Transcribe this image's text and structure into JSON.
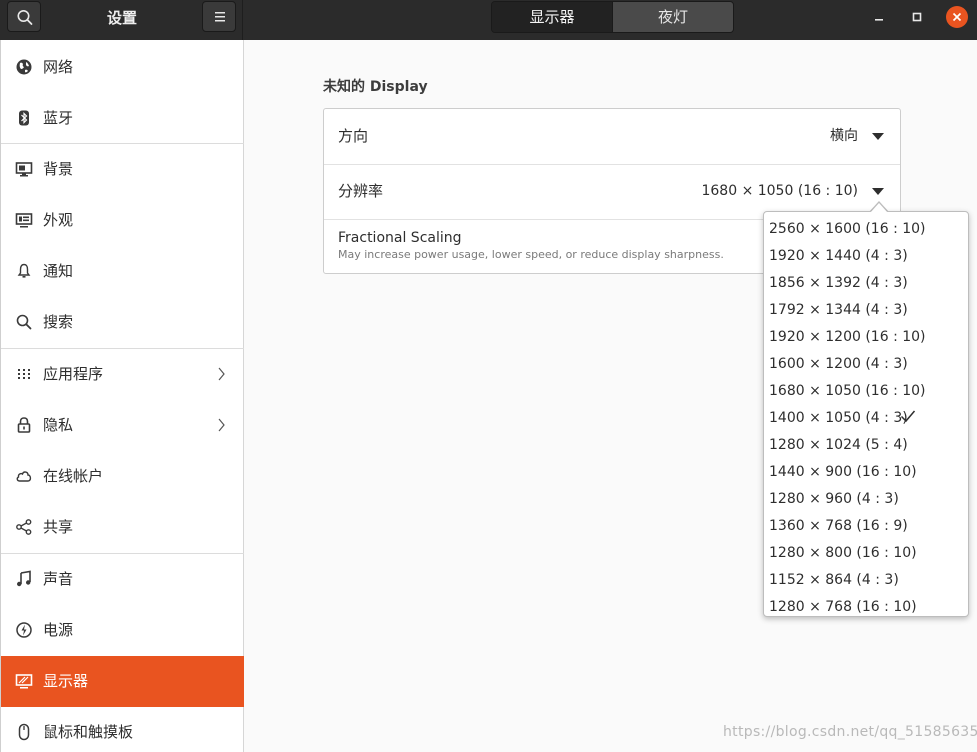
{
  "header": {
    "app_title": "设置",
    "tabs": [
      {
        "label": "显示器",
        "active": true
      },
      {
        "label": "夜灯",
        "active": false
      }
    ],
    "accent_color": "#e95420"
  },
  "sidebar": {
    "items": [
      {
        "label": "网络",
        "icon": "network-icon"
      },
      {
        "label": "蓝牙",
        "icon": "bluetooth-icon"
      },
      {
        "label": "背景",
        "icon": "background-icon"
      },
      {
        "label": "外观",
        "icon": "appearance-icon"
      },
      {
        "label": "通知",
        "icon": "bell-icon"
      },
      {
        "label": "搜索",
        "icon": "search-icon"
      },
      {
        "label": "应用程序",
        "icon": "apps-icon",
        "has_submenu": true
      },
      {
        "label": "隐私",
        "icon": "lock-icon",
        "has_submenu": true
      },
      {
        "label": "在线帐户",
        "icon": "cloud-icon"
      },
      {
        "label": "共享",
        "icon": "share-icon"
      },
      {
        "label": "声音",
        "icon": "music-note-icon"
      },
      {
        "label": "电源",
        "icon": "power-icon"
      },
      {
        "label": "显示器",
        "icon": "display-icon",
        "active": true
      },
      {
        "label": "鼠标和触摸板",
        "icon": "mouse-icon"
      }
    ]
  },
  "main": {
    "section_title": "未知的 Display",
    "orientation": {
      "label": "方向",
      "value": "横向"
    },
    "resolution": {
      "label": "分辨率",
      "value": "1680 × 1050 (16 : 10)"
    },
    "fractional_scaling": {
      "title": "Fractional Scaling",
      "subtitle": "May increase power usage, lower speed, or reduce display sharpness."
    }
  },
  "resolution_popover": {
    "options": [
      "2560 × 1600 (16 : 10)",
      "1920 × 1440 (4 : 3)",
      "1856 × 1392 (4 : 3)",
      "1792 × 1344 (4 : 3)",
      "1920 × 1200 (16 : 10)",
      "1600 × 1200 (4 : 3)",
      "1680 × 1050 (16 : 10)",
      "1400 × 1050 (4 : 3)",
      "1280 × 1024 (5 : 4)",
      "1440 × 900 (16 : 10)",
      "1280 × 960 (4 : 3)",
      "1360 × 768 (16 : 9)",
      "1280 × 800 (16 : 10)",
      "1152 × 864 (4 : 3)",
      "1280 × 768 (16 : 10)"
    ],
    "checked_option": "1400 × 1050 (4 : 3)"
  },
  "watermark": "https://blog.csdn.net/qq_51585635"
}
